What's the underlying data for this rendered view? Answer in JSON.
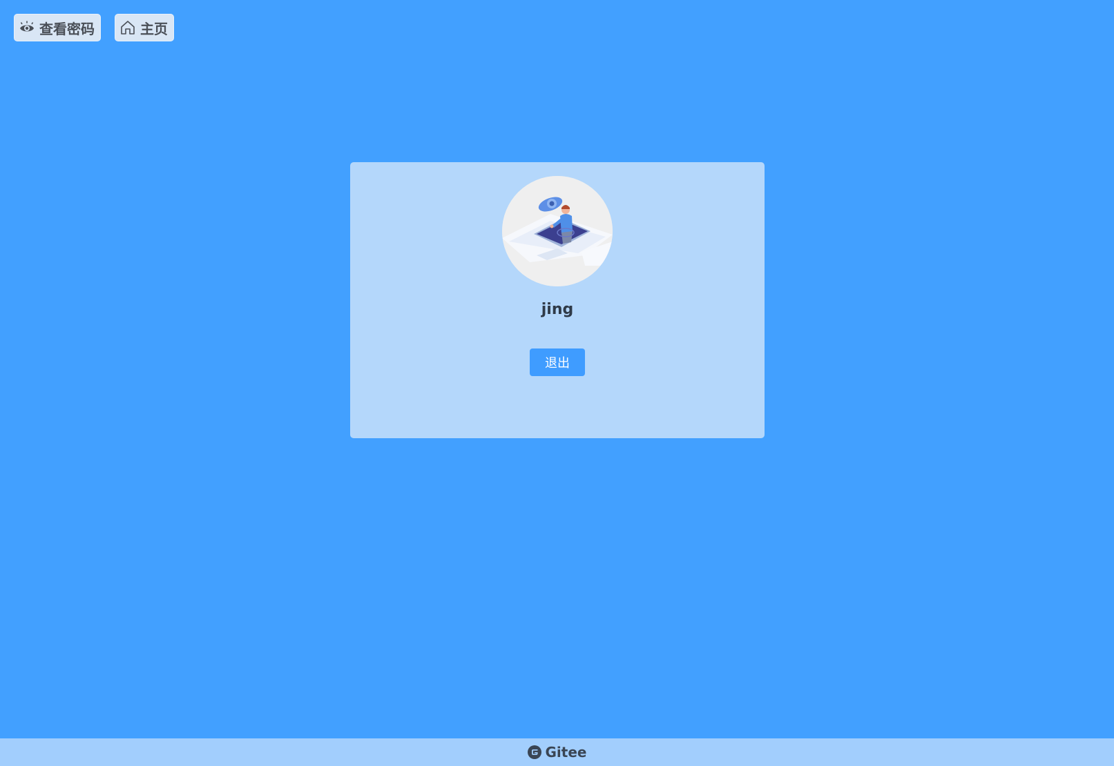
{
  "topbar": {
    "view_password": {
      "label": "查看密码",
      "icon": "eye-icon"
    },
    "home": {
      "label": "主页",
      "icon": "home-icon"
    }
  },
  "profile": {
    "avatar_alt": "user avatar illustration",
    "username": "jing",
    "logout_label": "退出"
  },
  "footer": {
    "brand": "Gitee",
    "icon": "gitee-logo-icon"
  },
  "colors": {
    "background": "#42a0ff",
    "card": "#b4d7fb",
    "button": "#3f9cff",
    "footer": "#a2cefd"
  }
}
